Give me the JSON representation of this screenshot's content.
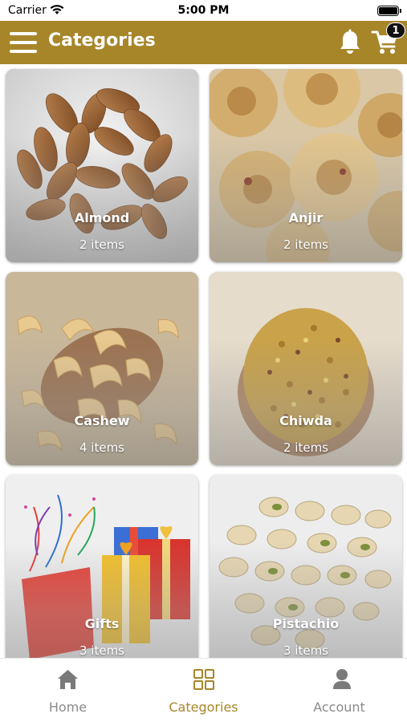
{
  "status_bar": {
    "carrier": "Carrier",
    "time": "5:00 PM"
  },
  "header": {
    "title": "Categories",
    "cart_count": "1",
    "icons": [
      "menu-icon",
      "bell-icon",
      "cart-icon"
    ],
    "background": "#a7862a"
  },
  "categories": [
    {
      "name": "Almond",
      "count": "2 items"
    },
    {
      "name": "Anjir",
      "count": "2 items"
    },
    {
      "name": "Cashew",
      "count": "4 items"
    },
    {
      "name": "Chiwda",
      "count": "2 items"
    },
    {
      "name": "Gifts",
      "count": "3 items"
    },
    {
      "name": "Pistachio",
      "count": "3 items"
    }
  ],
  "tabs": [
    {
      "label": "Home",
      "icon": "home-icon",
      "active": false
    },
    {
      "label": "Categories",
      "icon": "grid-icon",
      "active": true
    },
    {
      "label": "Account",
      "icon": "person-icon",
      "active": false
    }
  ],
  "colors": {
    "accent": "#a7862a",
    "inactive": "#8a8a8a"
  }
}
